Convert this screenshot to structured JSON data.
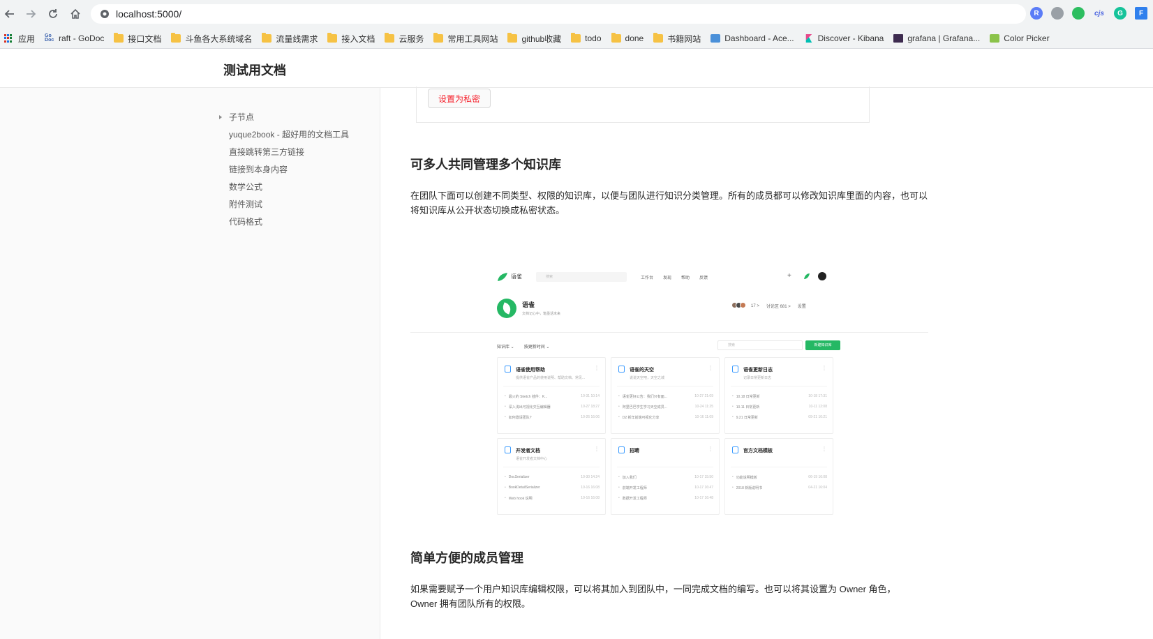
{
  "browser": {
    "url": "localhost:5000/",
    "bookmarks": [
      {
        "label": "应用",
        "icon": "apps-icon"
      },
      {
        "label": "raft - GoDoc",
        "icon": "godoc-icon"
      },
      {
        "label": "接口文档",
        "icon": "folder-icon"
      },
      {
        "label": "斗鱼各大系统域名",
        "icon": "folder-icon"
      },
      {
        "label": "流量线需求",
        "icon": "folder-icon"
      },
      {
        "label": "接入文档",
        "icon": "folder-icon"
      },
      {
        "label": "云服务",
        "icon": "folder-icon"
      },
      {
        "label": "常用工具网站",
        "icon": "folder-icon"
      },
      {
        "label": "github收藏",
        "icon": "folder-icon"
      },
      {
        "label": "todo",
        "icon": "folder-icon"
      },
      {
        "label": "done",
        "icon": "folder-icon"
      },
      {
        "label": "书籍网站",
        "icon": "folder-icon"
      },
      {
        "label": "Dashboard - Ace...",
        "icon": "dashboard-icon"
      },
      {
        "label": "Discover - Kibana",
        "icon": "kibana-icon"
      },
      {
        "label": "grafana | Grafana...",
        "icon": "grafana-icon"
      },
      {
        "label": "Color Picker",
        "icon": "color-picker-icon"
      }
    ]
  },
  "site": {
    "title": "测试用文档"
  },
  "toc": [
    {
      "label": "子节点",
      "expandable": true
    },
    {
      "label": "yuque2book - 超好用的文档工具",
      "expandable": false
    },
    {
      "label": "直接跳转第三方链接",
      "expandable": false
    },
    {
      "label": "链接到本身内容",
      "expandable": false
    },
    {
      "label": "数学公式",
      "expandable": false
    },
    {
      "label": "附件测试",
      "expandable": false
    },
    {
      "label": "代码格式",
      "expandable": false
    }
  ],
  "content": {
    "private_button": "设置为私密",
    "section1_title": "可多人共同管理多个知识库",
    "section1_text": "在团队下面可以创建不同类型、权限的知识库，以便与团队进行知识分类管理。所有的成员都可以修改知识库里面的内容，也可以将知识库从公开状态切换成私密状态。",
    "section2_title": "简单方便的成员管理",
    "section2_text": "如果需要赋予一个用户知识库编辑权限，可以将其加入到团队中，一同完成文档的编写。也可以将其设置为 Owner 角色，Owner 拥有团队所有的权限。"
  },
  "mock": {
    "brand": "语雀",
    "search_placeholder": "搜索",
    "nav": [
      "工作台",
      "发现",
      "帮助",
      "反馈"
    ],
    "team_name": "语雀",
    "team_desc": "文档记心中，笔墨话未来",
    "stats": {
      "members": "17 >",
      "discuss": "讨论区 681 >",
      "settings": "设置"
    },
    "filter1": "知识库 ⌄",
    "filter2": "按更新时间 ⌄",
    "search2_placeholder": "搜索",
    "new_button": "新建知识库",
    "cards": [
      {
        "title": "语雀使用帮助",
        "sub": "提供语雀产品的使用说明、帮助文档、常见...",
        "rows": [
          [
            "最火的 Sketch 插件：K...",
            "10-31 10:14"
          ],
          [
            "深入浅出可视化交互编辑器",
            "10-27 18:27"
          ],
          [
            "如何邀请团队?",
            "10-26 16:06"
          ]
        ]
      },
      {
        "title": "语雀的天空",
        "sub": "说说天空吧，天空之城",
        "rows": [
          [
            "语雀更好公告：我们只有面...",
            "10-27 21:09"
          ],
          [
            "阿里巴巴学生学习天空成员...",
            "10-24 11:25"
          ],
          [
            "D2 新年前端可视化分享",
            "10-16 11:09"
          ]
        ]
      },
      {
        "title": "语雀更新日志",
        "sub": "记录日常更新日志",
        "rows": [
          [
            "10.18 日常更新",
            "10-18 17:31"
          ],
          [
            "10.11 日常更新",
            "10-11 12:08"
          ],
          [
            "9.21 日常更新",
            "09-21 10:21"
          ]
        ]
      },
      {
        "title": "开发者文档",
        "sub": "语雀开发者文档中心",
        "rows": [
          [
            "DocSerializer",
            "10-30 14:24"
          ],
          [
            "BookDetailSerializer",
            "10-16 16:08"
          ],
          [
            "Web hook 说明",
            "10-16 16:08"
          ]
        ]
      },
      {
        "title": "招聘",
        "sub": "",
        "rows": [
          [
            "加入我们",
            "10-17 15:50"
          ],
          [
            "前端开发工程师",
            "10-17 16:47"
          ],
          [
            "数据开发工程师",
            "10-17 16:48"
          ]
        ]
      },
      {
        "title": "官方文档模板",
        "sub": "",
        "rows": [
          [
            "功能说明模板",
            "06-19 16:08"
          ],
          [
            "2018 新版说明书",
            "04-21 16:04"
          ]
        ]
      }
    ]
  },
  "colors": {
    "accent_red": "#f5222d",
    "brand_green": "#25b864"
  }
}
